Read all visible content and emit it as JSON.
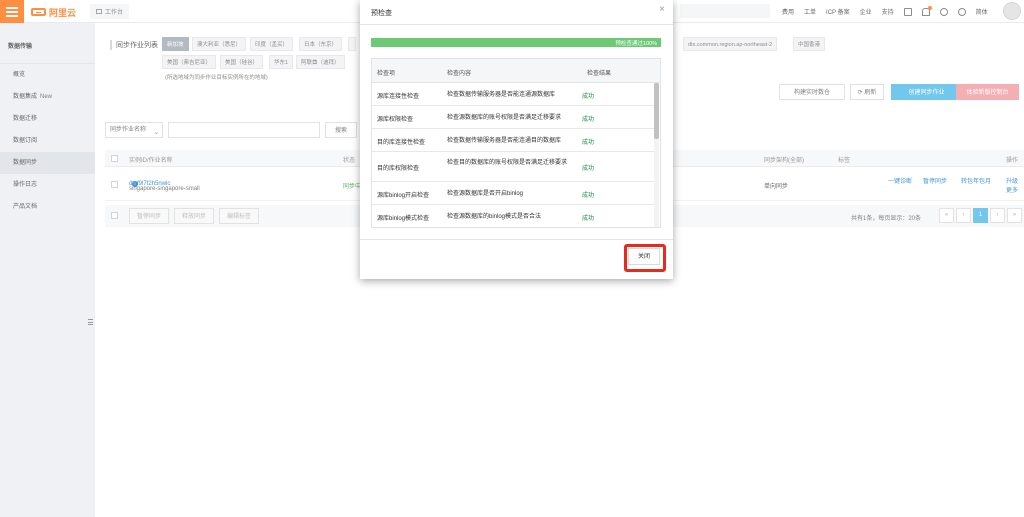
{
  "topbar": {
    "brand": "阿里云",
    "workbench": "工作台",
    "links": [
      "费用",
      "工单",
      "ICP 备案",
      "企业",
      "支持"
    ],
    "language": "简体"
  },
  "sidebar": {
    "title": "数据传输",
    "items": [
      {
        "label": "概览",
        "badge": ""
      },
      {
        "label": "数据集成",
        "badge": "New"
      },
      {
        "label": "数据迁移",
        "badge": ""
      },
      {
        "label": "数据订阅",
        "badge": ""
      },
      {
        "label": "数据同步",
        "badge": ""
      },
      {
        "label": "操作日志",
        "badge": ""
      },
      {
        "label": "产品文档",
        "badge": ""
      }
    ],
    "active_index": 4
  },
  "main": {
    "region_label": "同步作业列表",
    "regions": [
      "新加坡",
      "澳大利亚（悉尼）",
      "印度（孟买）",
      "日本（东京）",
      "dts.common.region.ap-northeast-2",
      "中国香港",
      "美国（弗吉尼亚）",
      "美国（硅谷）",
      "华东1",
      "阿联酋（迪拜）"
    ],
    "region_note": "(所选地域为同步作业目标实例所在的地域)",
    "actions": {
      "refresh_live": "构建实时数仓",
      "refresh": "刷新",
      "create": "创建同步作业",
      "try_console": "体验新版控制台"
    },
    "filter": {
      "select": "同步作业名称",
      "search_button": "搜索"
    },
    "table": {
      "headers": {
        "id": "实例ID/作业名称",
        "status": "状态",
        "arch": "同步架构(全部)",
        "tag": "标签",
        "ops": "操作"
      },
      "rows": [
        {
          "id": "dtsf9l7f2h5nwlc",
          "name": "singapore-singapore-small",
          "status": "同步中",
          "arch": "单向同步",
          "ops": [
            "一键诊断",
            "暂停同步",
            "转包年包月",
            "升级",
            "更多"
          ]
        }
      ],
      "footer_buttons": [
        "暂停同步",
        "释放同步",
        "编辑标签"
      ],
      "pagination": {
        "summary": "共有1条，每页显示：20条",
        "current_page": "1"
      }
    }
  },
  "modal": {
    "title": "预检查",
    "progress_percent": 100,
    "progress_text": "预检查通过100%",
    "columns": [
      "检查项",
      "检查内容",
      "检查结果"
    ],
    "rows": [
      {
        "item": "源库连接性检查",
        "content": "检查数据传输服务器是否能连通源数据库",
        "result": "成功"
      },
      {
        "item": "源库权限检查",
        "content": "检查源数据库的账号权限是否满足迁移要求",
        "result": "成功"
      },
      {
        "item": "目的库连接性检查",
        "content": "检查数据传输服务器是否能连通目的数据库",
        "result": "成功"
      },
      {
        "item": "目的库权限检查",
        "content": "检查目的数据库的账号权限是否满足迁移要求",
        "result": "成功"
      },
      {
        "item": "源库binlog开启检查",
        "content": "检查源数据库是否开启binlog",
        "result": "成功"
      },
      {
        "item": "源库binlog模式检查",
        "content": "检查源数据库的binlog模式是否合法",
        "result": "成功"
      }
    ],
    "close_label": "关闭"
  },
  "colors": {
    "brand": "#ff6a00",
    "primary": "#42b4e6",
    "success": "#1e8e3e",
    "progress": "#6dc976",
    "highlight": "#e8291c"
  }
}
